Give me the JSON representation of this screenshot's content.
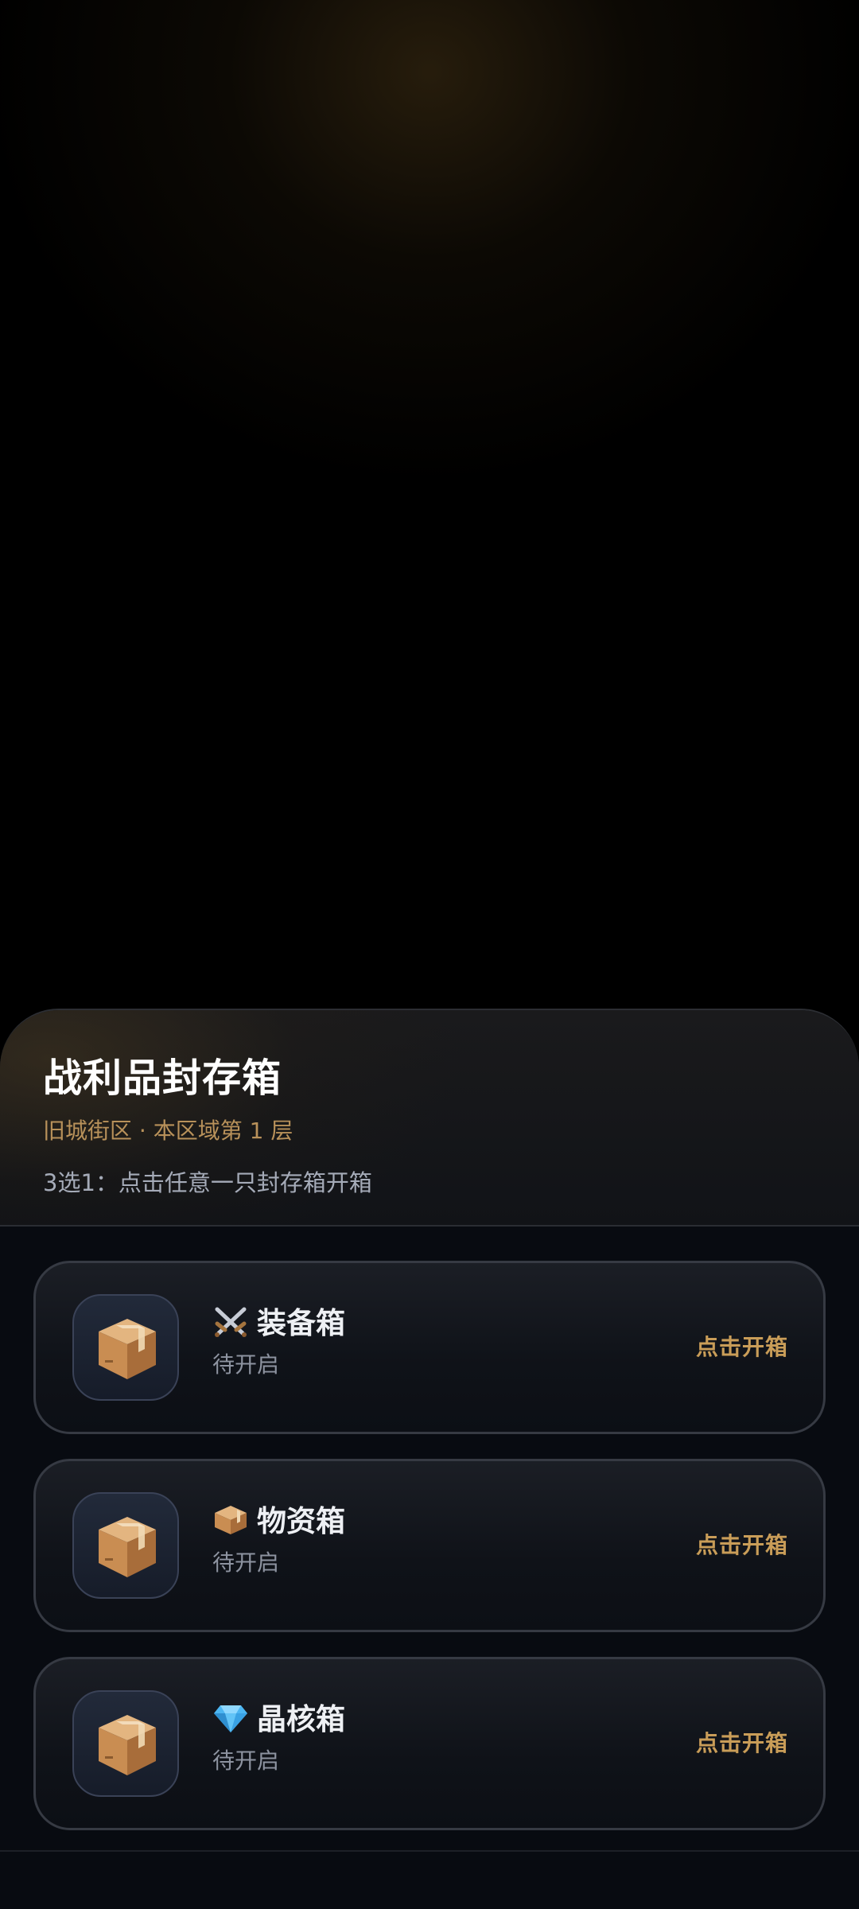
{
  "sheet": {
    "title": "战利品封存箱",
    "subtitle": "旧城街区 · 本区域第 1 层",
    "hint": "3选1：点击任意一只封存箱开箱"
  },
  "boxes": [
    {
      "name": "装备箱",
      "emoji_icon": "crossed-swords-icon",
      "status": "待开启",
      "action_label": "点击开箱"
    },
    {
      "name": "物资箱",
      "emoji_icon": "package-icon",
      "status": "待开启",
      "action_label": "点击开箱"
    },
    {
      "name": "晶核箱",
      "emoji_icon": "gem-icon",
      "status": "待开启",
      "action_label": "点击开箱"
    }
  ],
  "colors": {
    "accent_gold": "#c99d58",
    "subtitle_gold": "#b8915a",
    "card_border": "#363a43",
    "background": "#000000"
  }
}
